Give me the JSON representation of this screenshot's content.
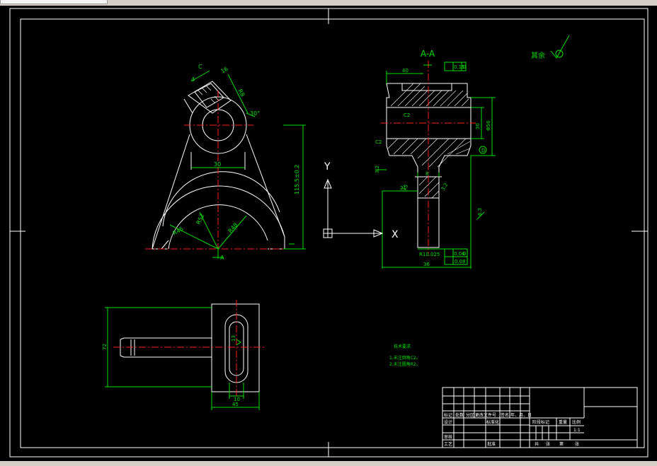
{
  "views": {
    "section_title": "A-A",
    "roughness_note": "其余"
  },
  "ucs": {
    "y_label": "Y",
    "x_label": "X"
  },
  "front_view": {
    "dims": {
      "c": "C",
      "four": "4",
      "r16": "16",
      "r8": "R8",
      "deg30": "30°",
      "w30": "30",
      "h": "115.5±0.2",
      "r_inner": "R52",
      "r_mid": "R48",
      "r_outer": "R45",
      "a_mark": "A"
    }
  },
  "section_view": {
    "dims": {
      "w40": "40",
      "tol_box": "0.15",
      "datum_d": "D",
      "c2": "C2",
      "c2b": "C2",
      "d30": "30",
      "d56": "Φ56",
      "d30r": "Φ30",
      "ra32": "3.2",
      "w21": "21",
      "w8": "8",
      "w15": "15",
      "ra63": "6.3",
      "sym_tol": "0.04",
      "sym_datum": "D",
      "flat_tol": "0.08",
      "tail": "R10.025",
      "width_bottom": "36"
    }
  },
  "top_view": {
    "dims": {
      "h72": "72",
      "w45": "45",
      "w10": "10",
      "r13": "13"
    }
  },
  "notes": {
    "title": "技术要求",
    "line1": "1.未注倒角C2。",
    "line2": "2.未注圆角R2。"
  },
  "title_block": {
    "row_headers": [
      "标记",
      "处数",
      "分区",
      "更改文件号",
      "签名",
      "年、月、日"
    ],
    "design": "设计",
    "standardize": "标准化",
    "review": "审核",
    "process": "工艺",
    "approve": "批准",
    "stage_headers": [
      "阶段标记",
      "重量",
      "比例"
    ],
    "scale": "1:1",
    "sheets": [
      "共",
      "张",
      "第",
      "张"
    ]
  }
}
